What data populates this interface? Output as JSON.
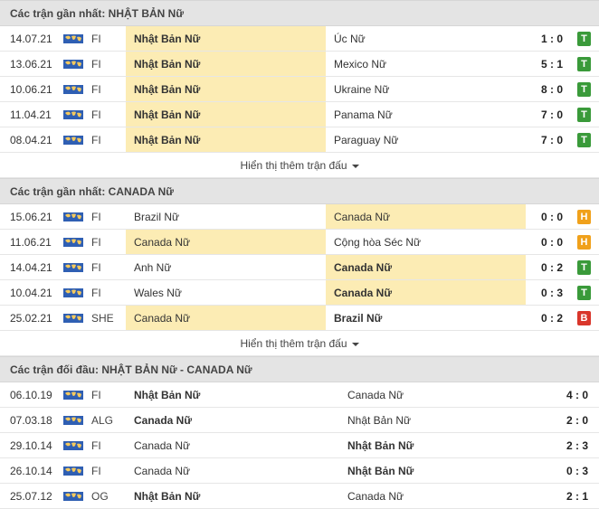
{
  "colors": {
    "highlight": "#fcecb4",
    "win": "#3a9a3a",
    "draw": "#f0a11b",
    "loss": "#d9362b"
  },
  "flag_icon": "world-map-flag-icon",
  "show_more_label": "Hiển thị thêm trận đấu",
  "sections": [
    {
      "title": "Các trận gần nhất: NHẬT BẢN Nữ",
      "show_more": true,
      "h2h": false,
      "rows": [
        {
          "date": "14.07.21",
          "league": "FI",
          "home": "Nhật Bản Nữ",
          "away": "Úc Nữ",
          "score": "1 : 0",
          "result": "T",
          "hl": "home",
          "bold": "home"
        },
        {
          "date": "13.06.21",
          "league": "FI",
          "home": "Nhật Bản Nữ",
          "away": "Mexico Nữ",
          "score": "5 : 1",
          "result": "T",
          "hl": "home",
          "bold": "home"
        },
        {
          "date": "10.06.21",
          "league": "FI",
          "home": "Nhật Bản Nữ",
          "away": "Ukraine Nữ",
          "score": "8 : 0",
          "result": "T",
          "hl": "home",
          "bold": "home"
        },
        {
          "date": "11.04.21",
          "league": "FI",
          "home": "Nhật Bản Nữ",
          "away": "Panama Nữ",
          "score": "7 : 0",
          "result": "T",
          "hl": "home",
          "bold": "home"
        },
        {
          "date": "08.04.21",
          "league": "FI",
          "home": "Nhật Bản Nữ",
          "away": "Paraguay Nữ",
          "score": "7 : 0",
          "result": "T",
          "hl": "home",
          "bold": "home"
        }
      ]
    },
    {
      "title": "Các trận gần nhất: CANADA Nữ",
      "show_more": true,
      "h2h": false,
      "rows": [
        {
          "date": "15.06.21",
          "league": "FI",
          "home": "Brazil Nữ",
          "away": "Canada Nữ",
          "score": "0 : 0",
          "result": "H",
          "hl": "away",
          "bold": ""
        },
        {
          "date": "11.06.21",
          "league": "FI",
          "home": "Canada Nữ",
          "away": "Cộng hòa Séc Nữ",
          "score": "0 : 0",
          "result": "H",
          "hl": "home",
          "bold": ""
        },
        {
          "date": "14.04.21",
          "league": "FI",
          "home": "Anh Nữ",
          "away": "Canada Nữ",
          "score": "0 : 2",
          "result": "T",
          "hl": "away",
          "bold": "away"
        },
        {
          "date": "10.04.21",
          "league": "FI",
          "home": "Wales Nữ",
          "away": "Canada Nữ",
          "score": "0 : 3",
          "result": "T",
          "hl": "away",
          "bold": "away"
        },
        {
          "date": "25.02.21",
          "league": "SHE",
          "home": "Canada Nữ",
          "away": "Brazil Nữ",
          "score": "0 : 2",
          "result": "B",
          "hl": "home",
          "bold": "away"
        }
      ]
    },
    {
      "title": "Các trận đối đầu: NHẬT BẢN Nữ - CANADA Nữ",
      "show_more": false,
      "h2h": true,
      "rows": [
        {
          "date": "06.10.19",
          "league": "FI",
          "home": "Nhật Bản Nữ",
          "away": "Canada Nữ",
          "score": "4 : 0",
          "result": "",
          "hl": "",
          "bold": "home"
        },
        {
          "date": "07.03.18",
          "league": "ALG",
          "home": "Canada Nữ",
          "away": "Nhật Bản Nữ",
          "score": "2 : 0",
          "result": "",
          "hl": "",
          "bold": "home"
        },
        {
          "date": "29.10.14",
          "league": "FI",
          "home": "Canada Nữ",
          "away": "Nhật Bản Nữ",
          "score": "2 : 3",
          "result": "",
          "hl": "",
          "bold": "away"
        },
        {
          "date": "26.10.14",
          "league": "FI",
          "home": "Canada Nữ",
          "away": "Nhật Bản Nữ",
          "score": "0 : 3",
          "result": "",
          "hl": "",
          "bold": "away"
        },
        {
          "date": "25.07.12",
          "league": "OG",
          "home": "Nhật Bản Nữ",
          "away": "Canada Nữ",
          "score": "2 : 1",
          "result": "",
          "hl": "",
          "bold": "home"
        }
      ]
    }
  ]
}
